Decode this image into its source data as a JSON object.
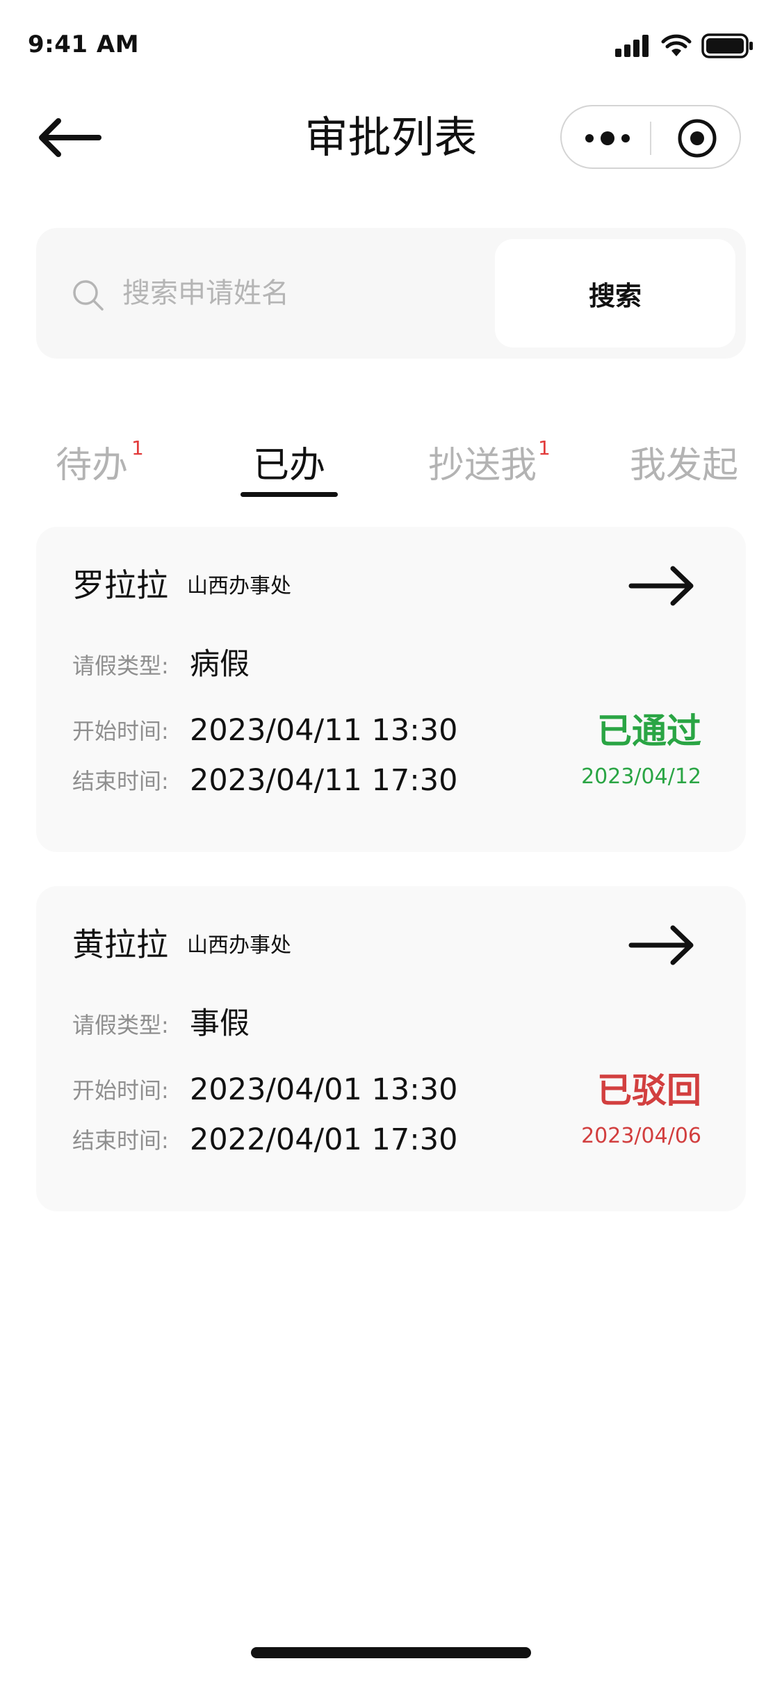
{
  "status_bar": {
    "time": "9:41 AM"
  },
  "nav": {
    "title": "审批列表",
    "back_icon": "arrow-left-icon",
    "more_icon": "more-dots-icon",
    "close_icon": "target-circle-icon"
  },
  "search": {
    "placeholder": "搜索申请姓名",
    "value": "",
    "button_label": "搜索"
  },
  "tabs": [
    {
      "label": "待办",
      "badge": "1",
      "active": false
    },
    {
      "label": "已办",
      "badge": "",
      "active": true
    },
    {
      "label": "抄送我",
      "badge": "1",
      "active": false
    },
    {
      "label": "我发起",
      "badge": "",
      "active": false
    }
  ],
  "cards": [
    {
      "name": "罗拉拉",
      "dept": "山西办事处",
      "leave_type_label": "请假类型:",
      "leave_type": "病假",
      "start_label": "开始时间:",
      "start": "2023/04/11 13:30",
      "end_label": "结束时间:",
      "end": "2023/04/11 17:30",
      "status": "已通过",
      "status_date": "2023/04/12",
      "status_color": "#2aa544"
    },
    {
      "name": "黄拉拉",
      "dept": "山西办事处",
      "leave_type_label": "请假类型:",
      "leave_type": "事假",
      "start_label": "开始时间:",
      "start": "2023/04/01 13:30",
      "end_label": "结束时间:",
      "end": "2022/04/01 17:30",
      "status": "已驳回",
      "status_date": "2023/04/06",
      "status_color": "#d23f3f"
    }
  ],
  "colors": {
    "text_primary": "#111111",
    "text_muted": "#8f8f8f",
    "tab_inactive": "#b3b3b3",
    "badge": "#e23b3b",
    "panel_bg": "#f7f7f7",
    "card_bg": "#f9f9f9"
  }
}
